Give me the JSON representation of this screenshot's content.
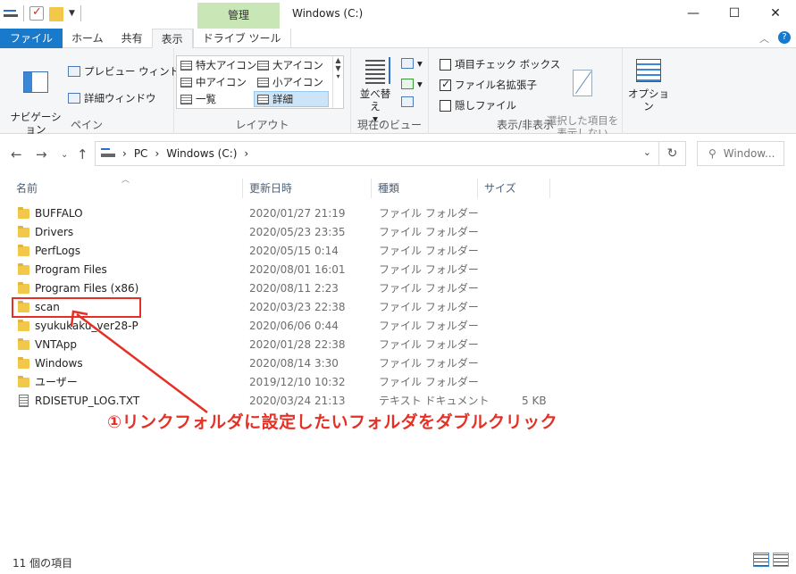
{
  "window": {
    "title": "Windows (C:)",
    "tool_tab_header": "管理",
    "controls": {
      "minimize": "—",
      "maximize": "☐",
      "close": "✕"
    }
  },
  "tabs": {
    "file": "ファイル",
    "home": "ホーム",
    "share": "共有",
    "view": "表示",
    "drive_tools": "ドライブ ツール"
  },
  "ribbon": {
    "pane": {
      "label": "ペイン",
      "navigation_pane": "ナビゲーション\nウィンドウ",
      "preview_pane": "プレビュー ウィンドウ",
      "details_pane": "詳細ウィンドウ"
    },
    "layout": {
      "label": "レイアウト",
      "extra_large": "特大アイコン",
      "large": "大アイコン",
      "medium": "中アイコン",
      "small": "小アイコン",
      "list": "一覧",
      "details": "詳細"
    },
    "current_view": {
      "label": "現在のビュー",
      "sort": "並べ替え"
    },
    "show_hide": {
      "label": "表示/非表示",
      "item_checkboxes": "項目チェック ボックス",
      "file_extensions": "ファイル名拡張子",
      "hidden_items": "隠しファイル",
      "hide_selected": "選択した項目を\n表示しない"
    },
    "options": "オプション"
  },
  "address": {
    "breadcrumb": [
      "PC",
      "Windows (C:)"
    ],
    "search_placeholder": "Window..."
  },
  "columns": {
    "name": "名前",
    "date": "更新日時",
    "type": "種類",
    "size": "サイズ"
  },
  "files": [
    {
      "name": "BUFFALO",
      "date": "2020/01/27 21:19",
      "type": "ファイル フォルダー",
      "size": ""
    },
    {
      "name": "Drivers",
      "date": "2020/05/23 23:35",
      "type": "ファイル フォルダー",
      "size": ""
    },
    {
      "name": "PerfLogs",
      "date": "2020/05/15 0:14",
      "type": "ファイル フォルダー",
      "size": ""
    },
    {
      "name": "Program Files",
      "date": "2020/08/01 16:01",
      "type": "ファイル フォルダー",
      "size": ""
    },
    {
      "name": "Program Files (x86)",
      "date": "2020/08/11 2:23",
      "type": "ファイル フォルダー",
      "size": ""
    },
    {
      "name": "scan",
      "date": "2020/03/23 22:38",
      "type": "ファイル フォルダー",
      "size": ""
    },
    {
      "name": "syukukaku_ver28-P",
      "date": "2020/06/06 0:44",
      "type": "ファイル フォルダー",
      "size": ""
    },
    {
      "name": "VNTApp",
      "date": "2020/01/28 22:38",
      "type": "ファイル フォルダー",
      "size": ""
    },
    {
      "name": "Windows",
      "date": "2020/08/14 3:30",
      "type": "ファイル フォルダー",
      "size": ""
    },
    {
      "name": "ユーザー",
      "date": "2019/12/10 10:32",
      "type": "ファイル フォルダー",
      "size": ""
    },
    {
      "name": "RDISETUP_LOG.TXT",
      "date": "2020/03/24 21:13",
      "type": "テキスト ドキュメント",
      "size": "5 KB"
    }
  ],
  "annotation": "①リンクフォルダに設定したいフォルダをダブルクリック",
  "status": "11 個の項目",
  "colors": {
    "accent": "#1979ca",
    "annotation": "#e53026",
    "tool_tab": "#c9e6b6",
    "folder": "#f2c84b"
  }
}
